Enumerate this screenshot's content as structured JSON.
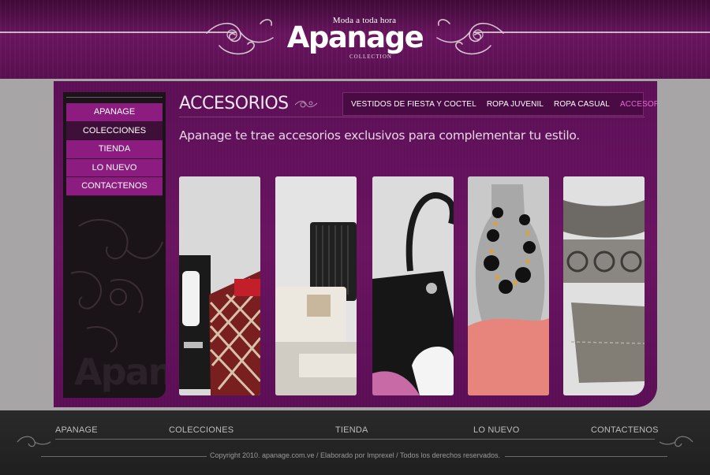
{
  "header": {
    "tagline": "Moda a toda hora",
    "brand": "Apanage",
    "collection_label": "COLLECTION"
  },
  "sidebar": {
    "items": [
      {
        "label": "APANAGE"
      },
      {
        "label": "COLECCIONES"
      },
      {
        "label": "TIENDA"
      },
      {
        "label": "LO NUEVO"
      },
      {
        "label": "CONTACTENOS"
      }
    ],
    "active_index": 1,
    "watermark": "Apana"
  },
  "main": {
    "title": "ACCESORIOS",
    "intro": "Apanage te trae accesorios exclusivos para complementar tu estilo.",
    "topnav": [
      {
        "label": "VESTIDOS DE FIESTA Y COCTEL"
      },
      {
        "label": "ROPA JUVENIL"
      },
      {
        "label": "ROPA CASUAL"
      },
      {
        "label": "ACCESORIOS"
      }
    ],
    "gallery": [
      {
        "subject": "red-lattice-handbag"
      },
      {
        "subject": "white-and-black-clutches"
      },
      {
        "subject": "black-leather-handbag"
      },
      {
        "subject": "bead-necklace-on-bust"
      },
      {
        "subject": "metallic-belts"
      }
    ]
  },
  "footer": {
    "nav": [
      {
        "label": "APANAGE"
      },
      {
        "label": "COLECCIONES"
      },
      {
        "label": "TIENDA"
      },
      {
        "label": "LO NUEVO"
      },
      {
        "label": "CONTACTENOS"
      }
    ],
    "copyright": "Copyright 2010. apanage.com.ve / Elaborado por Imprexel / Todos los derechos reservados."
  },
  "colors": {
    "header_purple": "#6a1560",
    "menu_magenta": "#8d1c80",
    "active_topnav": "#e26cd5",
    "footer_dark": "#222222"
  }
}
